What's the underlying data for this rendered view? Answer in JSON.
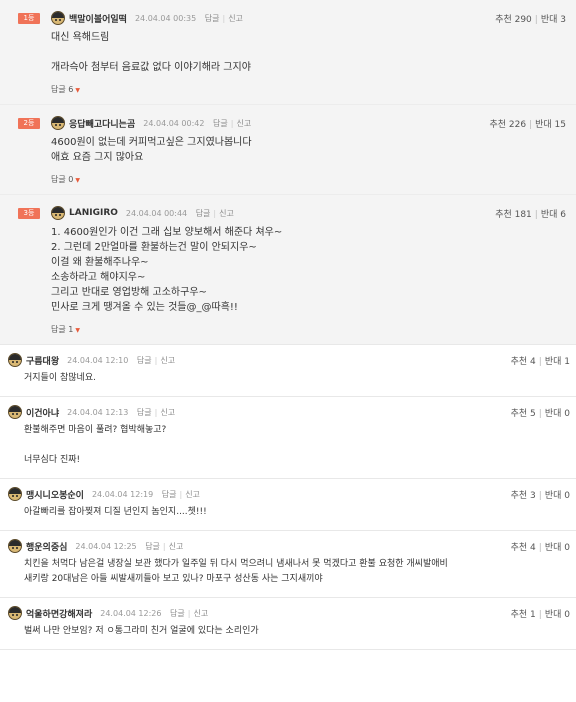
{
  "best_comments": [
    {
      "rank": "1등",
      "nick": "백말이볼어일떡",
      "date": "24.04.04 00:35",
      "reply_label": "답글",
      "report_label": "신고",
      "up_label": "추천 290",
      "down_label": "반대 3",
      "lines": [
        "대신 욕해드림",
        "",
        "개라슥아 첨부터 음료값 없다 이야기해라 그지야"
      ],
      "replies_label": "답글 6"
    },
    {
      "rank": "2등",
      "nick": "응답빼고다니는곰",
      "date": "24.04.04 00:42",
      "reply_label": "답글",
      "report_label": "신고",
      "up_label": "추천 226",
      "down_label": "반대 15",
      "lines": [
        "4600원이 없는데 커피먹고싶은 그지였나봅니다",
        "애효 요즘 그지 많아요"
      ],
      "replies_label": "답글 0"
    },
    {
      "rank": "3등",
      "nick": "LANIGIRO",
      "date": "24.04.04 00:44",
      "reply_label": "답글",
      "report_label": "신고",
      "up_label": "추천 181",
      "down_label": "반대 6",
      "lines": [
        "1. 4600원인가 이건 그래 십보 양보해서 해준다 쳐우~",
        "2. 그런데 2만얼마를 환불하는건 말이 안되지우~",
        "이걸 왜 환불해주나우~",
        "소송하라고 해야지우~",
        "그리고 반대로 영업방해 고소하구우~",
        "민사로 크게 땡겨올 수 있는 것들@_@따흑!!"
      ],
      "replies_label": "답글 1"
    }
  ],
  "comments": [
    {
      "nick": "구름대왕",
      "date": "24.04.04 12:10",
      "reply_label": "답글",
      "report_label": "신고",
      "up_label": "추천 4",
      "down_label": "반대 1",
      "lines": [
        "거지들이 참많네요."
      ]
    },
    {
      "nick": "이건아냐",
      "date": "24.04.04 12:13",
      "reply_label": "답글",
      "report_label": "신고",
      "up_label": "추천 5",
      "down_label": "반대 0",
      "lines": [
        "환불해주면 마음이 풀려? 협박해놓고?",
        "",
        "너무심다 진짜!"
      ]
    },
    {
      "nick": "맹시니오봉순이",
      "date": "24.04.04 12:19",
      "reply_label": "답글",
      "report_label": "신고",
      "up_label": "추천 3",
      "down_label": "반대 0",
      "lines": [
        "아갈빠리를 잡아찢져 디질 년인지 놈인지....쳇!!!"
      ]
    },
    {
      "nick": "행운의중심",
      "date": "24.04.04 12:25",
      "reply_label": "답글",
      "report_label": "신고",
      "up_label": "추천 4",
      "down_label": "반대 0",
      "lines": [
        "치킨을 처먹다 남은걸 냉장실 보관 했다가 일주일 뒤 다시 먹으려니 냄새나서 못 먹겠다고 환불 요청한 개씨발애비",
        "새키랑 20대남은 아들 씨발새끼들아 보고 있나? 마포구 성산동 사는 그지새끼야"
      ]
    },
    {
      "nick": "억울하면강해져라",
      "date": "24.04.04 12:26",
      "reply_label": "답글",
      "report_label": "신고",
      "up_label": "추천 1",
      "down_label": "반대 0",
      "lines": [
        "벌써 나만 안보임? 저 ㅇ통그라미 친거 얼굴에 있다는 소리인가"
      ]
    }
  ],
  "colors": {
    "rank_badge": "#f07358",
    "caret": "#e85a3a",
    "best_bg": "#f4f4f4"
  },
  "icons": {
    "avatar": "avatar-icon",
    "caret": "caret-down-icon"
  }
}
